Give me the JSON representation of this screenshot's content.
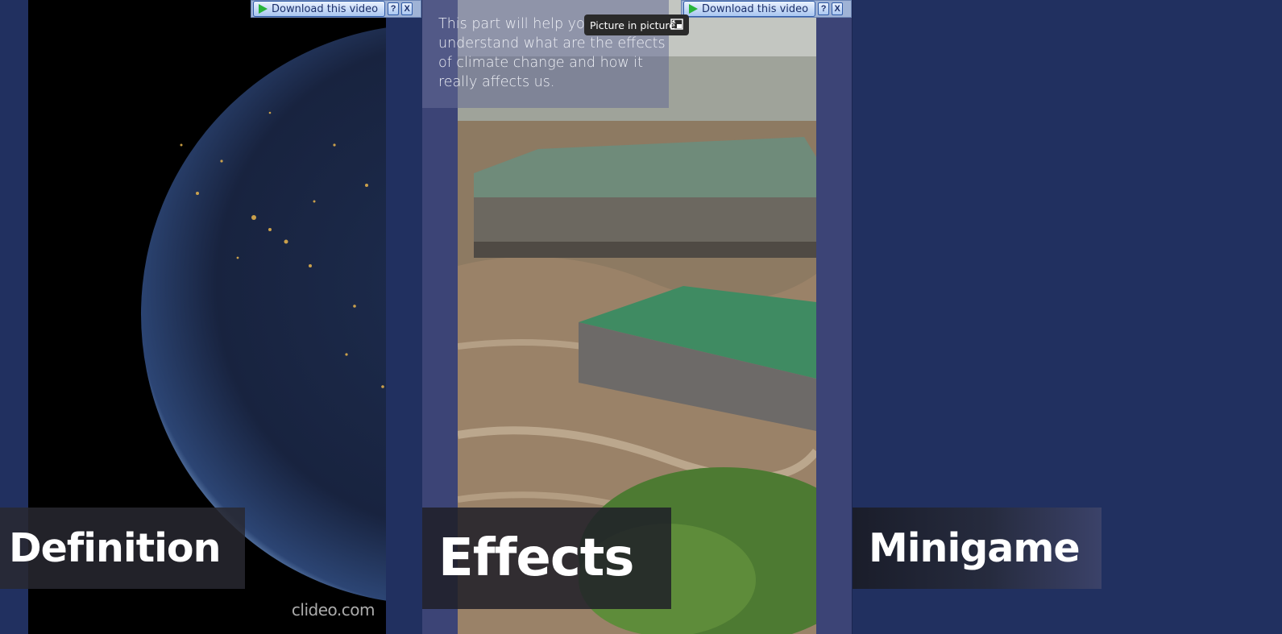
{
  "toolbar_left": {
    "download_label": "Download this video",
    "help_label": "?",
    "close_label": "X"
  },
  "toolbar_right": {
    "download_label": "Download this video",
    "help_label": "?",
    "close_label": "X"
  },
  "pip_tooltip": {
    "label": "Picture in picture"
  },
  "panels": {
    "definition": {
      "title": "Definition",
      "watermark": "clideo.com"
    },
    "effects": {
      "title": "Effects",
      "description": "This part will help you understand what are the effects of climate change and how it really affects us."
    },
    "minigame": {
      "title": "Minigame"
    }
  },
  "colors": {
    "page_bg": "#213060",
    "panel_bg": "#3c4476",
    "download_play": "#28b43a"
  }
}
